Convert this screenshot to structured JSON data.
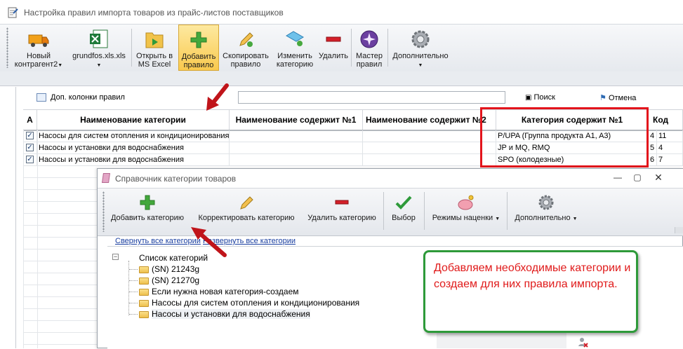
{
  "window": {
    "title": "Настройка правил импорта товаров из прайс-листов поставщиков"
  },
  "toolbar": {
    "new_contractor": "Новый\nконтрагент2",
    "file": "grundfos.xls.xls",
    "open_excel": "Открыть в\nMS Excel",
    "add_rule": "Добавить\nправило",
    "copy_rule": "Скопировать\nправило",
    "change_category": "Изменить\nкатегорию",
    "delete": "Удалить",
    "wizard": "Мастер\nправил",
    "more": "Дополнительно"
  },
  "grid_toolbar": {
    "extra_columns": "Доп. колонки правил",
    "search": "Поиск",
    "cancel": "Отмена"
  },
  "table": {
    "headers": [
      "A",
      "Наименование категории",
      "Наименование содержит №1",
      "Наименование содержит №2",
      "Категория содержит №1",
      "Код"
    ],
    "rows": [
      {
        "name": "Насосы для систем отопления и кондиционирования",
        "category": "P/UPA (Группа продукта A1, A3)",
        "code": "4",
        "extra": "11"
      },
      {
        "name": "Насосы и установки для водоснабжения",
        "category": "JP и MQ, RMQ",
        "code": "5",
        "extra": "4"
      },
      {
        "name": "Насосы и установки для водоснабжения",
        "category": "SPO (колодезные)",
        "code": "6",
        "extra": "7"
      }
    ]
  },
  "dialog": {
    "title": "Справочник категории товаров",
    "toolbar": {
      "add_category": "Добавить категорию",
      "edit_category": "Корректировать категорию",
      "delete_category": "Удалить категорию",
      "select": "Выбор",
      "markup_modes": "Режимы наценки",
      "more": "Дополнительно"
    },
    "links": {
      "collapse_all": "Свернуть все категории",
      "expand_all": "Развернуть все категории"
    },
    "tree": {
      "root": "Список категорий",
      "items": [
        "(SN) 21243g",
        "(SN) 21270g",
        "Если нужна новая категория-создаем",
        "Насосы для систем отопления и кондиционирования",
        "Насосы и установки для водоснабжения"
      ]
    }
  },
  "callout": {
    "text": "Добавляем необходимые категории и создаем для них правила импорта."
  },
  "colors": {
    "highlight_red": "#e3141c",
    "callout_green": "#2e9a3a",
    "callout_text": "#e01a1a",
    "link_blue": "#1a3fa0"
  }
}
